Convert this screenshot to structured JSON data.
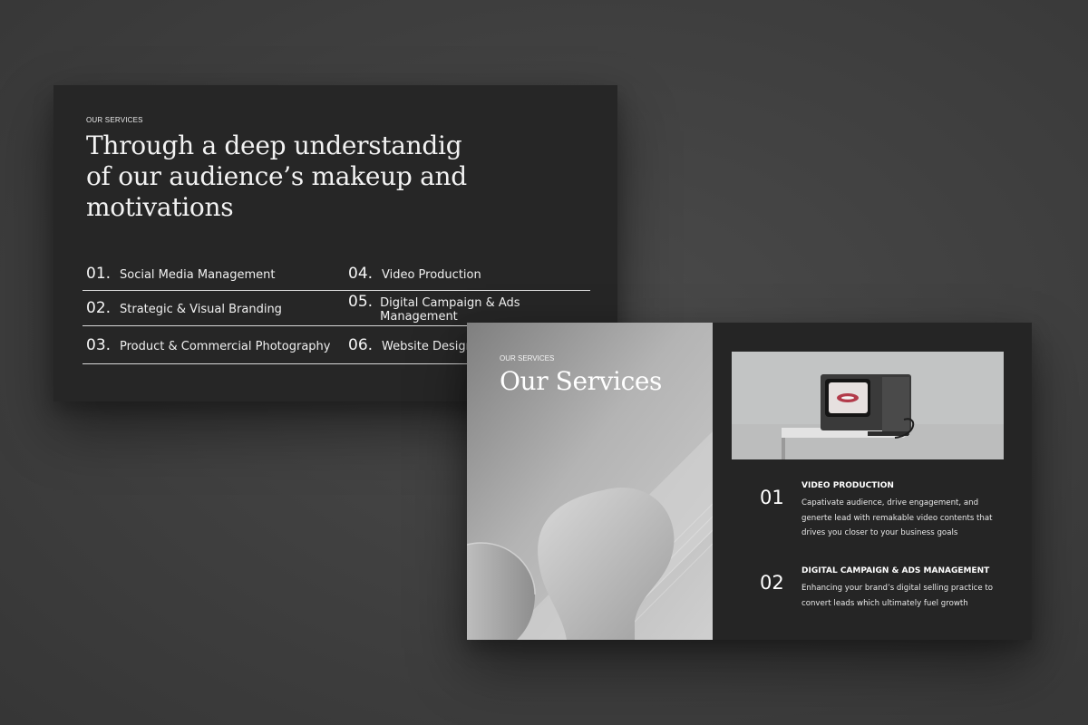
{
  "slide1": {
    "eyebrow": "OUR SERVICES",
    "headline": "Through a deep understandig of our audience’s makeup and motivations",
    "services": [
      [
        {
          "num": "01.",
          "label": "Social Media Management"
        },
        {
          "num": "04.",
          "label": "Video Production"
        }
      ],
      [
        {
          "num": "02.",
          "label": "Strategic & Visual Branding"
        },
        {
          "num": "05.",
          "label": "Digital Campaign & Ads Management"
        }
      ],
      [
        {
          "num": "03.",
          "label": "Product & Commercial Photography"
        },
        {
          "num": "06.",
          "label": "Website Design"
        }
      ]
    ]
  },
  "slide2": {
    "eyebrow": "OUR SERVICES",
    "title": "Our Services",
    "items": [
      {
        "num": "01",
        "title": "VIDEO PRODUCTION",
        "desc": "Capativate audience, drive engagement, and generte lead with remakable video contents that drives you closer to your business goals"
      },
      {
        "num": "02",
        "title": "DIGITAL CAMPAIGN & ADS MANAGEMENT",
        "desc": "Enhancing your brand’s digital selling practice to convert leads which ultimately fuel growth"
      }
    ]
  },
  "colors": {
    "background": "#3f3f3f",
    "slide": "#262626",
    "text": "#f2f2f2",
    "divider": "#d9d9d9"
  }
}
